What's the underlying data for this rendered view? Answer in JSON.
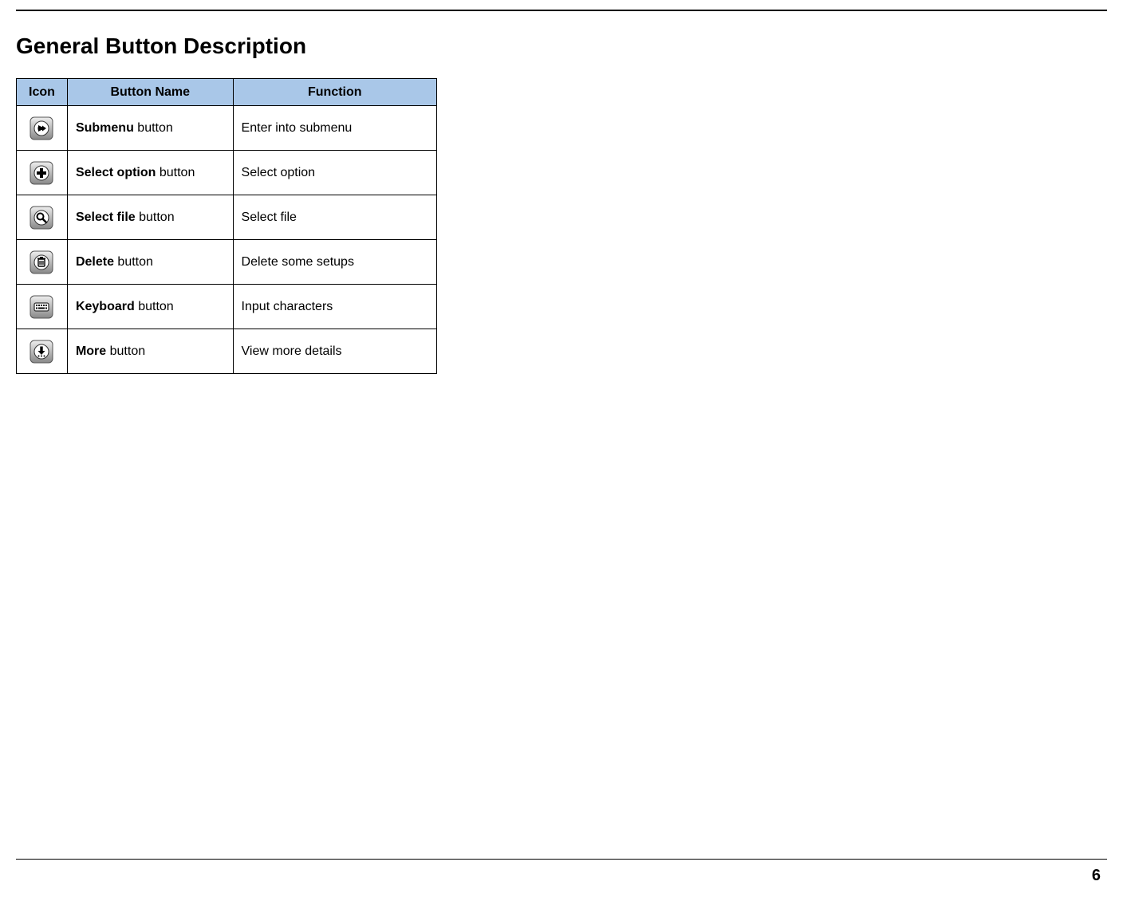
{
  "page": {
    "title": "General Button Description",
    "number": "6"
  },
  "table": {
    "headers": {
      "icon": "Icon",
      "name": "Button Name",
      "func": "Function"
    },
    "rows": [
      {
        "icon": "arrow-right",
        "name_bold": "Submenu",
        "name_rest": " button",
        "func": "Enter into submenu"
      },
      {
        "icon": "plus",
        "name_bold": "Select option",
        "name_rest": " button",
        "func": "Select option"
      },
      {
        "icon": "magnifier",
        "name_bold": "Select file",
        "name_rest": " button",
        "func": "Select file"
      },
      {
        "icon": "trash",
        "name_bold": "Delete",
        "name_rest": " button",
        "func": "Delete some setups"
      },
      {
        "icon": "keyboard",
        "name_bold": "Keyboard",
        "name_rest": " button",
        "func": "Input characters"
      },
      {
        "icon": "download",
        "name_bold": "More",
        "name_rest": " button",
        "func": "View more details"
      }
    ]
  }
}
